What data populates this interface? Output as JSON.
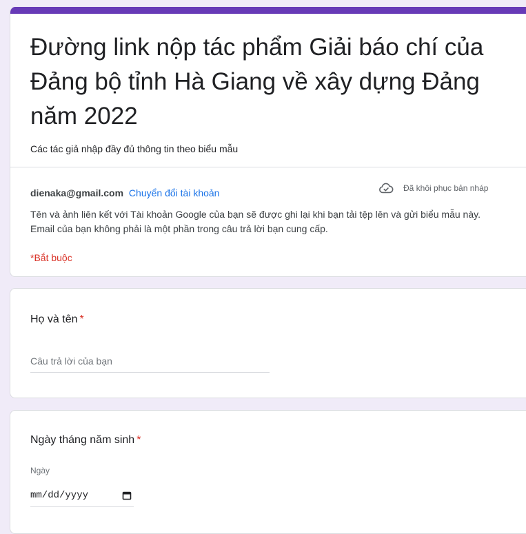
{
  "form": {
    "title": "Đường link nộp tác phẩm Giải báo chí của Đảng bộ tỉnh Hà Giang về xây dựng Đảng năm 2022",
    "description": "Các tác giả nhập đầy đủ thông tin theo biểu mẫu",
    "accent_color": "#673ab7"
  },
  "account": {
    "email": "dienaka@gmail.com",
    "switch_label": "Chuyển đổi tài khoản",
    "draft_status": "Đã khôi phục bản nháp",
    "draft_icon": "cloud-done-icon"
  },
  "notice": "Tên và ảnh liên kết với Tài khoản Google của bạn sẽ được ghi lại khi bạn tải tệp lên và gửi biểu mẫu này. Email của bạn không phải là một phần trong câu trả lời bạn cung cấp.",
  "required_note": "*Bắt buộc",
  "questions": {
    "name": {
      "title": "Họ và tên",
      "required_mark": "*",
      "placeholder": "Câu trả lời của bạn"
    },
    "dob": {
      "title": "Ngày tháng năm sinh",
      "required_mark": "*",
      "sub_label": "Ngày",
      "date_value": "mm/dd/yyyy",
      "calendar_icon": "calendar-icon"
    }
  },
  "colors": {
    "background": "#f0ebf8",
    "link": "#1a73e8",
    "required": "#d93025"
  }
}
